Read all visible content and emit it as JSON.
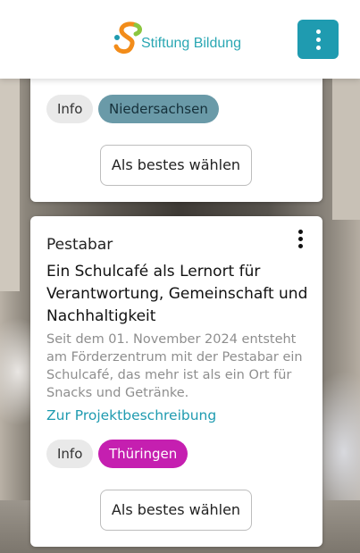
{
  "header": {
    "logo_text": "Stiftung Bildung",
    "menu_icon": "kebab-menu-icon",
    "accent_color": "#1f9bb0"
  },
  "cards": [
    {
      "tags": [
        "Info",
        "Niedersachsen"
      ],
      "vote_label": "Als bestes wählen"
    },
    {
      "org": "Pestabar",
      "title": "Ein Schulcafé als Lernort für Verantwortung, Gemeinschaft und Nachhaltigkeit",
      "description": "Seit dem 01. November 2024 entsteht am Förderzentrum mit der Pestabar ein Schulcafé, das mehr ist als ein Ort für Snacks und Getränke.",
      "link": "Zur Projektbeschreibung",
      "tags": [
        "Info",
        "Thüringen"
      ],
      "tag_color": "#c51fb0",
      "vote_label": "Als bestes wählen"
    }
  ]
}
